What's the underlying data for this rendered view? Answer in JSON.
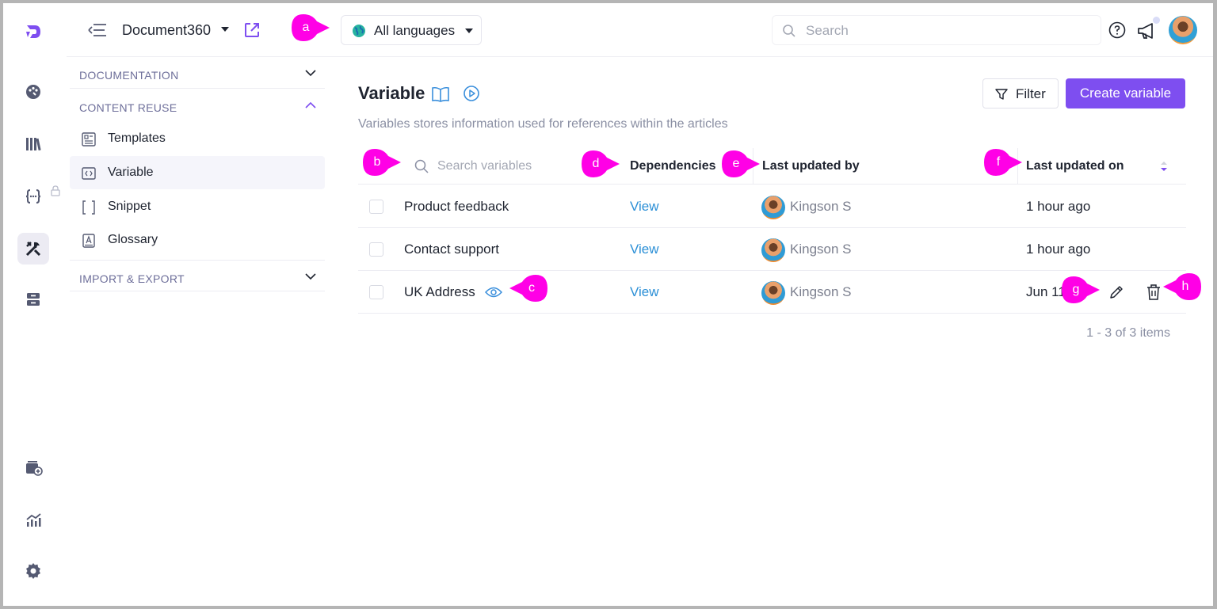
{
  "topbar": {
    "project_name": "Document360",
    "language": "All languages",
    "search_placeholder": "Search"
  },
  "subnav": {
    "sections": [
      {
        "label": "DOCUMENTATION",
        "expanded": false
      },
      {
        "label": "CONTENT REUSE",
        "expanded": true
      },
      {
        "label": "IMPORT & EXPORT",
        "expanded": false
      }
    ],
    "items": [
      {
        "label": "Templates",
        "icon": "templates-icon"
      },
      {
        "label": "Variable",
        "icon": "variable-icon",
        "active": true
      },
      {
        "label": "Snippet",
        "icon": "snippet-icon"
      },
      {
        "label": "Glossary",
        "icon": "glossary-icon"
      }
    ]
  },
  "main": {
    "title": "Variable",
    "subtitle": "Variables stores information used for references within the articles",
    "filter_label": "Filter",
    "create_label": "Create variable",
    "table": {
      "search_placeholder": "Search variables",
      "columns": [
        "Dependencies",
        "Last updated by",
        "Last updated on"
      ],
      "rows": [
        {
          "name": "Product feedback",
          "dependencies": "View",
          "updated_by": "Kingson S",
          "updated_on": "1 hour ago"
        },
        {
          "name": "Contact support",
          "dependencies": "View",
          "updated_by": "Kingson S",
          "updated_on": "1 hour ago"
        },
        {
          "name": "UK Address",
          "dependencies": "View",
          "updated_by": "Kingson S",
          "updated_on": "Jun 11"
        }
      ]
    },
    "pagination": "1 - 3 of 3 items"
  },
  "callouts": [
    "a",
    "b",
    "c",
    "d",
    "e",
    "f",
    "g",
    "h"
  ],
  "colors": {
    "accent": "#7e4ef0",
    "link": "#2b8fd6",
    "callout": "#ff00e6"
  }
}
